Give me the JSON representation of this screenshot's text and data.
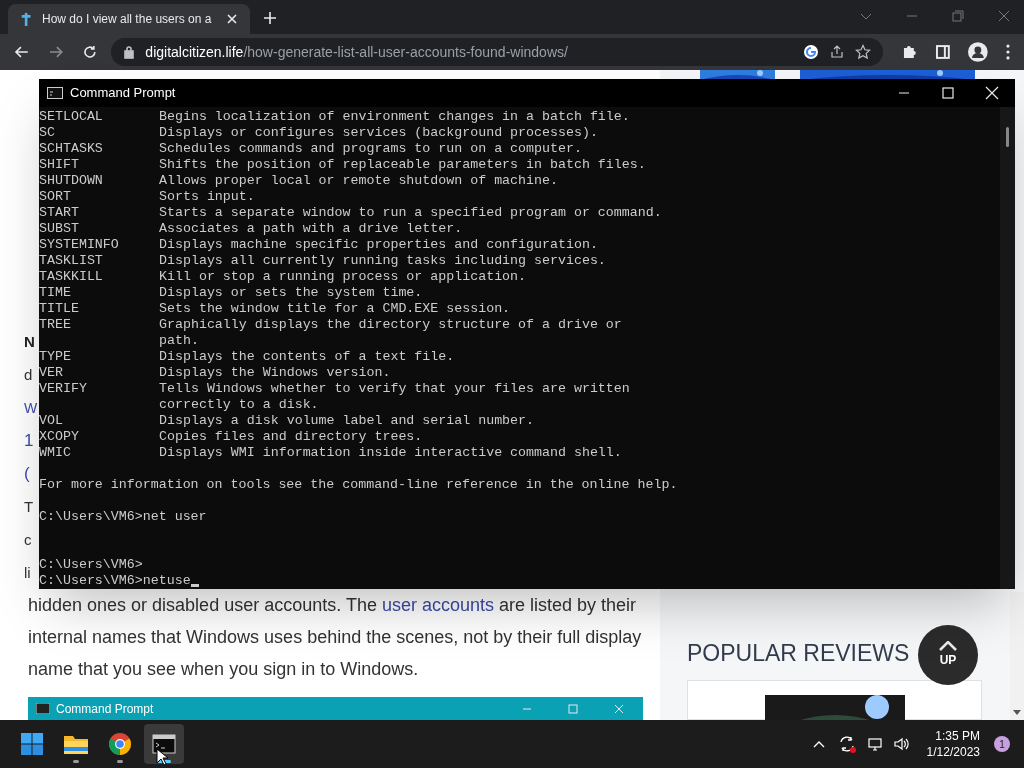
{
  "browser": {
    "tab": {
      "title": "How do I view all the users on a",
      "selected": true
    },
    "url": {
      "host": "digitalcitizen.life",
      "path": "/how-generate-list-all-user-accounts-found-windows/"
    }
  },
  "article": {
    "fragments": [
      {
        "kind": "heading",
        "text": "N"
      },
      {
        "kind": "body",
        "text": "d"
      },
      {
        "kind": "link",
        "text": "W"
      },
      {
        "kind": "title",
        "text": "1"
      },
      {
        "kind": "title",
        "text": "("
      },
      {
        "kind": "body",
        "text": "T"
      },
      {
        "kind": "body",
        "text": "c"
      },
      {
        "kind": "body",
        "text": "li"
      }
    ],
    "paragraph": [
      {
        "kind": "text",
        "text": "hidden ones or disabled user accounts. The "
      },
      {
        "kind": "link",
        "text": "user accounts"
      },
      {
        "kind": "text",
        "text": " are listed by their internal names that Windows uses behind the scenes, not by their full display name that you see when you sign in to Windows."
      }
    ],
    "figure_title": "Command Prompt"
  },
  "sidebar": {
    "heading": "POPULAR REVIEWS",
    "up_button": "UP"
  },
  "console": {
    "title": "Command Prompt",
    "lines": [
      {
        "kind": "command",
        "name": "SETLOCAL",
        "description": "Begins localization of environment changes in a batch file."
      },
      {
        "kind": "command",
        "name": "SC",
        "description": "Displays or configures services (background processes)."
      },
      {
        "kind": "command",
        "name": "SCHTASKS",
        "description": "Schedules commands and programs to run on a computer."
      },
      {
        "kind": "command",
        "name": "SHIFT",
        "description": "Shifts the position of replaceable parameters in batch files."
      },
      {
        "kind": "command",
        "name": "SHUTDOWN",
        "description": "Allows proper local or remote shutdown of machine."
      },
      {
        "kind": "command",
        "name": "SORT",
        "description": "Sorts input."
      },
      {
        "kind": "command",
        "name": "START",
        "description": "Starts a separate window to run a specified program or command."
      },
      {
        "kind": "command",
        "name": "SUBST",
        "description": "Associates a path with a drive letter."
      },
      {
        "kind": "command",
        "name": "SYSTEMINFO",
        "description": "Displays machine specific properties and configuration."
      },
      {
        "kind": "command",
        "name": "TASKLIST",
        "description": "Displays all currently running tasks including services."
      },
      {
        "kind": "command",
        "name": "TASKKILL",
        "description": "Kill or stop a running process or application."
      },
      {
        "kind": "command",
        "name": "TIME",
        "description": "Displays or sets the system time."
      },
      {
        "kind": "command",
        "name": "TITLE",
        "description": "Sets the window title for a CMD.EXE session."
      },
      {
        "kind": "command",
        "name": "TREE",
        "description": "Graphically displays the directory structure of a drive or"
      },
      {
        "kind": "continuation",
        "text": "path."
      },
      {
        "kind": "command",
        "name": "TYPE",
        "description": "Displays the contents of a text file."
      },
      {
        "kind": "command",
        "name": "VER",
        "description": "Displays the Windows version."
      },
      {
        "kind": "command",
        "name": "VERIFY",
        "description": "Tells Windows whether to verify that your files are written"
      },
      {
        "kind": "continuation",
        "text": "correctly to a disk."
      },
      {
        "kind": "command",
        "name": "VOL",
        "description": "Displays a disk volume label and serial number."
      },
      {
        "kind": "command",
        "name": "XCOPY",
        "description": "Copies files and directory trees."
      },
      {
        "kind": "command",
        "name": "WMIC",
        "description": "Displays WMI information inside interactive command shell."
      },
      {
        "kind": "blank"
      },
      {
        "kind": "text",
        "text": "For more information on tools see the command-line reference in the online help."
      },
      {
        "kind": "blank"
      },
      {
        "kind": "text",
        "text": "C:\\Users\\VM6>net user"
      },
      {
        "kind": "blank"
      },
      {
        "kind": "blank"
      },
      {
        "kind": "text",
        "text": "C:\\Users\\VM6>"
      },
      {
        "kind": "input",
        "text": "C:\\Users\\VM6>netuse"
      }
    ]
  },
  "taskbar": {
    "time": "1:35 PM",
    "date": "1/12/2023",
    "notifications": "1",
    "apps": [
      {
        "kind": "explorer",
        "selected": false
      },
      {
        "kind": "chrome",
        "selected": false
      },
      {
        "kind": "terminal",
        "selected": true
      }
    ]
  }
}
